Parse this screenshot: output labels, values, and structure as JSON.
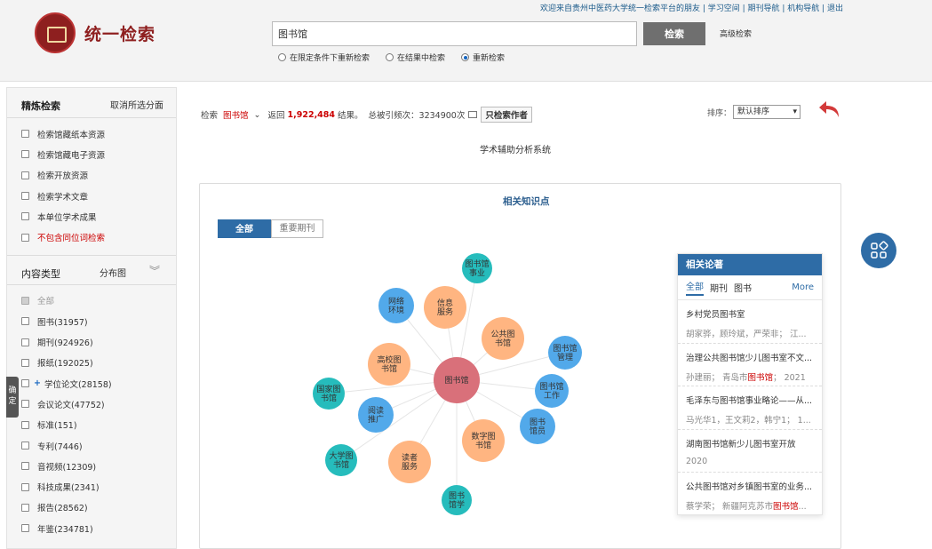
{
  "header": {
    "logo_text": "统一检索",
    "top_links": "欢迎来自贵州中医药大学统一检索平台的朋友 | 学习空间 | 期刊导航 | 机构导航 | 退出",
    "search_value": "图书馆",
    "search_button": "检索",
    "advanced_link": "高级检索",
    "radios": [
      {
        "label": "在限定条件下重新检索",
        "checked": false
      },
      {
        "label": "在结果中检索",
        "checked": false
      },
      {
        "label": "重新检索",
        "checked": true
      }
    ]
  },
  "sidebar": {
    "refine_title": "精炼检索",
    "cancel_link": "取消所选分面",
    "refine_items": [
      "检索馆藏纸本资源",
      "检索馆藏电子资源",
      "检索开放资源",
      "检索学术文章",
      "本单位学术成果",
      "不包含同位词检索"
    ],
    "type_title": "内容类型",
    "distribution_link": "分布图",
    "type_items": [
      "全部",
      "图书(31957)",
      "期刊(924926)",
      "报纸(192025)",
      "学位论文(28158)",
      "会议论文(47752)",
      "标准(151)",
      "专利(7446)",
      "音视频(12309)",
      "科技成果(2341)",
      "报告(28562)",
      "年鉴(234781)"
    ],
    "confirm_tab": "确定"
  },
  "results": {
    "search_label": "检索",
    "keyword": "图书馆",
    "returned_prefix": "返回",
    "count": "1,922,484",
    "returned_suffix": "结果。",
    "cited_label": "总被引频次：",
    "cited_value": "3234900次",
    "author_only_button": "只检索作者",
    "sort_label": "排序：",
    "sort_value": "默认排序",
    "system_title": "学术辅助分析系统"
  },
  "knowledge": {
    "title": "相关知识点",
    "tab_all": "全部",
    "tab_journal": "重要期刊",
    "center": "图书馆",
    "nodes": [
      {
        "label": "图书馆事业",
        "color": "#26bcbc"
      },
      {
        "label": "信息服务",
        "color": "#ffb581"
      },
      {
        "label": "网络环境",
        "color": "#52a9ea"
      },
      {
        "label": "公共图书馆",
        "color": "#ffb581"
      },
      {
        "label": "图书馆管理",
        "color": "#52a9ea"
      },
      {
        "label": "高校图书馆",
        "color": "#ffb581"
      },
      {
        "label": "图书馆工作",
        "color": "#52a9ea"
      },
      {
        "label": "国家图书馆",
        "color": "#26bcbc"
      },
      {
        "label": "阅读推广",
        "color": "#52a9ea"
      },
      {
        "label": "图书馆员",
        "color": "#52a9ea"
      },
      {
        "label": "数字图书馆",
        "color": "#ffb581"
      },
      {
        "label": "大学图书馆",
        "color": "#26bcbc"
      },
      {
        "label": "读者服务",
        "color": "#ffb581"
      },
      {
        "label": "图书馆学",
        "color": "#26bcbc"
      }
    ]
  },
  "related": {
    "title": "相关论著",
    "tabs": [
      "全部",
      "期刊",
      "图书"
    ],
    "more": "More",
    "items": [
      {
        "title": "乡村党员图书室",
        "meta_pre": "胡家骅，顾玲斌，严荣非； 江...",
        "meta_hl": "",
        "meta_post": ""
      },
      {
        "title": "治理公共图书馆少儿图书室不文...",
        "meta_pre": "孙建丽； 青岛市",
        "meta_hl": "图书馆",
        "meta_post": "； 2021"
      },
      {
        "title": "毛泽东与图书馆事业略论——从...",
        "meta_pre": "马光华1，王文莉2，韩宁1； 1...",
        "meta_hl": "",
        "meta_post": ""
      },
      {
        "title": "湖南图书馆新少儿图书室开放",
        "meta_pre": "2020",
        "meta_hl": "",
        "meta_post": ""
      },
      {
        "title": "公共图书馆对乡镇图书室的业务...",
        "meta_pre": "蔡学荣； 新疆阿克苏市",
        "meta_hl": "图书馆",
        "meta_post": "..."
      }
    ]
  }
}
